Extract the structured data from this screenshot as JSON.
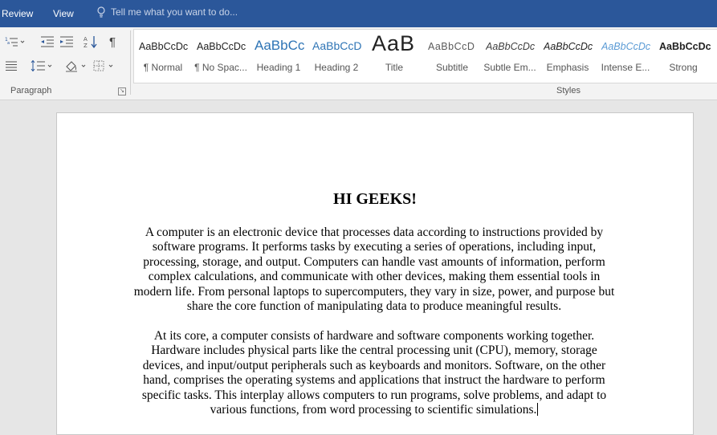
{
  "menubar": {
    "tabs": [
      {
        "label": "Review"
      },
      {
        "label": "View"
      }
    ],
    "tell_me": "Tell me what you want to do..."
  },
  "ribbon": {
    "paragraph_label": "Paragraph",
    "styles_label": "Styles",
    "paragraph_icons": {
      "multilevel": "multilevel-list-icon",
      "decrease_indent": "decrease-indent-icon",
      "increase_indent": "increase-indent-icon",
      "sort": "sort-icon",
      "show_marks": "pilcrow-icon",
      "justify": "justify-icon",
      "line_spacing": "line-spacing-icon",
      "shading": "shading-icon",
      "borders": "borders-icon"
    },
    "styles": [
      {
        "preview": "AaBbCcDc",
        "name": "¶ Normal"
      },
      {
        "preview": "AaBbCcDc",
        "name": "¶ No Spac..."
      },
      {
        "preview": "AaBbCc",
        "name": "Heading 1"
      },
      {
        "preview": "AaBbCcD",
        "name": "Heading 2"
      },
      {
        "preview": "AaB",
        "name": "Title"
      },
      {
        "preview": "AaBbCcD",
        "name": "Subtitle"
      },
      {
        "preview": "AaBbCcDc",
        "name": "Subtle Em..."
      },
      {
        "preview": "AaBbCcDc",
        "name": "Emphasis"
      },
      {
        "preview": "AaBbCcDc",
        "name": "Intense E..."
      },
      {
        "preview": "AaBbCcDc",
        "name": "Strong"
      }
    ]
  },
  "document": {
    "title": "HI GEEKS!",
    "paragraphs": [
      "A computer is an electronic device that processes data according to instructions provided by software programs. It performs tasks by executing a series of operations, including input, processing, storage, and output. Computers can handle vast amounts of information, perform complex calculations, and communicate with other devices, making them essential tools in modern life. From personal laptops to supercomputers, they vary in size, power, and purpose but share the core function of manipulating data to produce meaningful results.",
      "At its core, a computer consists of hardware and software components working together. Hardware includes physical parts like the central processing unit (CPU), memory, storage devices, and input/output peripherals such as keyboards and monitors. Software, on the other hand, comprises the operating systems and applications that instruct the hardware to perform specific tasks. This interplay allows computers to run programs, solve problems, and adapt to various functions, from word processing to scientific simulations."
    ]
  },
  "colors": {
    "ribbon_blue": "#2b579a",
    "heading_blue": "#2e74b5",
    "intense_blue": "#5b9bd5"
  }
}
